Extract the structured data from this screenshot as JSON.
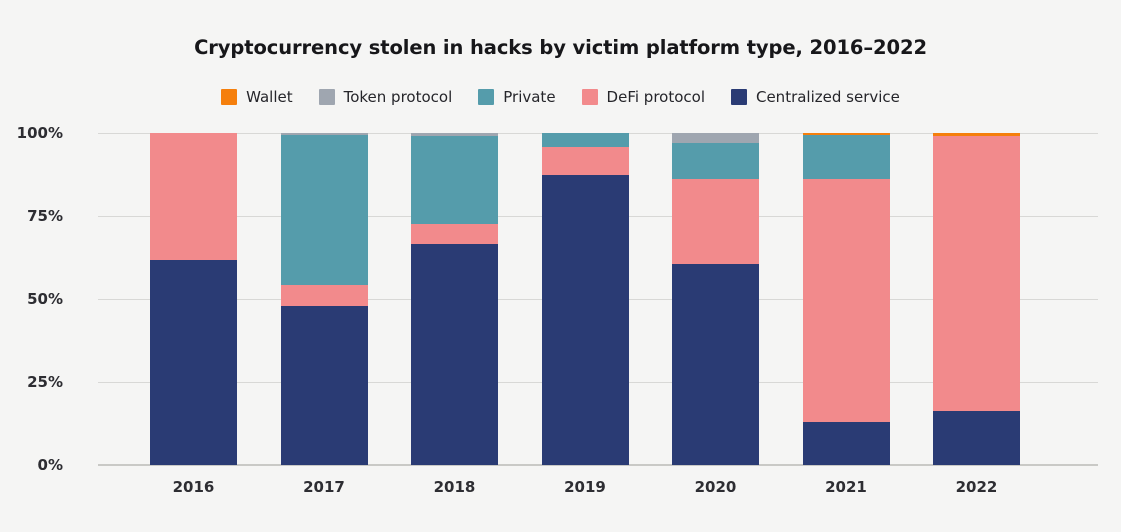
{
  "chart_data": {
    "type": "bar",
    "stacked": true,
    "stack_mode": "percent",
    "title": "Cryptocurrency stolen in hacks by victim platform type, 2016–2022",
    "subtitle": "",
    "xlabel": "",
    "ylabel": "",
    "categories": [
      "2016",
      "2017",
      "2018",
      "2019",
      "2020",
      "2021",
      "2022"
    ],
    "ylim": [
      0,
      100
    ],
    "ytick_labels": [
      "0%",
      "25%",
      "50%",
      "75%",
      "100%"
    ],
    "ytick_values": [
      0,
      25,
      50,
      75,
      100
    ],
    "grid": true,
    "legend_position": "top-center",
    "series": [
      {
        "name": "Centralized service",
        "color": "#2a3b74",
        "values": [
          61.8,
          47.9,
          66.5,
          87.5,
          60.5,
          13.0,
          16.3
        ]
      },
      {
        "name": "DeFi protocol",
        "color": "#f28a8c",
        "values": [
          38.2,
          6.2,
          6.0,
          8.3,
          25.5,
          73.0,
          82.7
        ]
      },
      {
        "name": "Private",
        "color": "#559cab",
        "values": [
          0.0,
          45.4,
          26.6,
          4.2,
          11.0,
          13.3,
          0.0
        ]
      },
      {
        "name": "Token protocol",
        "color": "#9fa6b0",
        "values": [
          0.0,
          0.5,
          0.9,
          0.0,
          3.0,
          0.0,
          0.0
        ]
      },
      {
        "name": "Wallet",
        "color": "#f57f0c",
        "values": [
          0.0,
          0.0,
          0.0,
          0.0,
          0.0,
          0.7,
          1.0
        ]
      }
    ]
  },
  "legend": {
    "items": [
      {
        "label": "Wallet",
        "color": "#f57f0c"
      },
      {
        "label": "Token protocol",
        "color": "#9fa6b0"
      },
      {
        "label": "Private",
        "color": "#559cab"
      },
      {
        "label": "DeFi protocol",
        "color": "#f28a8c"
      },
      {
        "label": "Centralized service",
        "color": "#2a3b74"
      }
    ]
  },
  "colors": {
    "background": "#f5f5f4",
    "gridline": "#d8d8d6",
    "text": "#25252a",
    "wallet": "#f57f0c",
    "token_protocol": "#9fa6b0",
    "private": "#559cab",
    "defi_protocol": "#f28a8c",
    "centralized_service": "#2a3b74"
  }
}
